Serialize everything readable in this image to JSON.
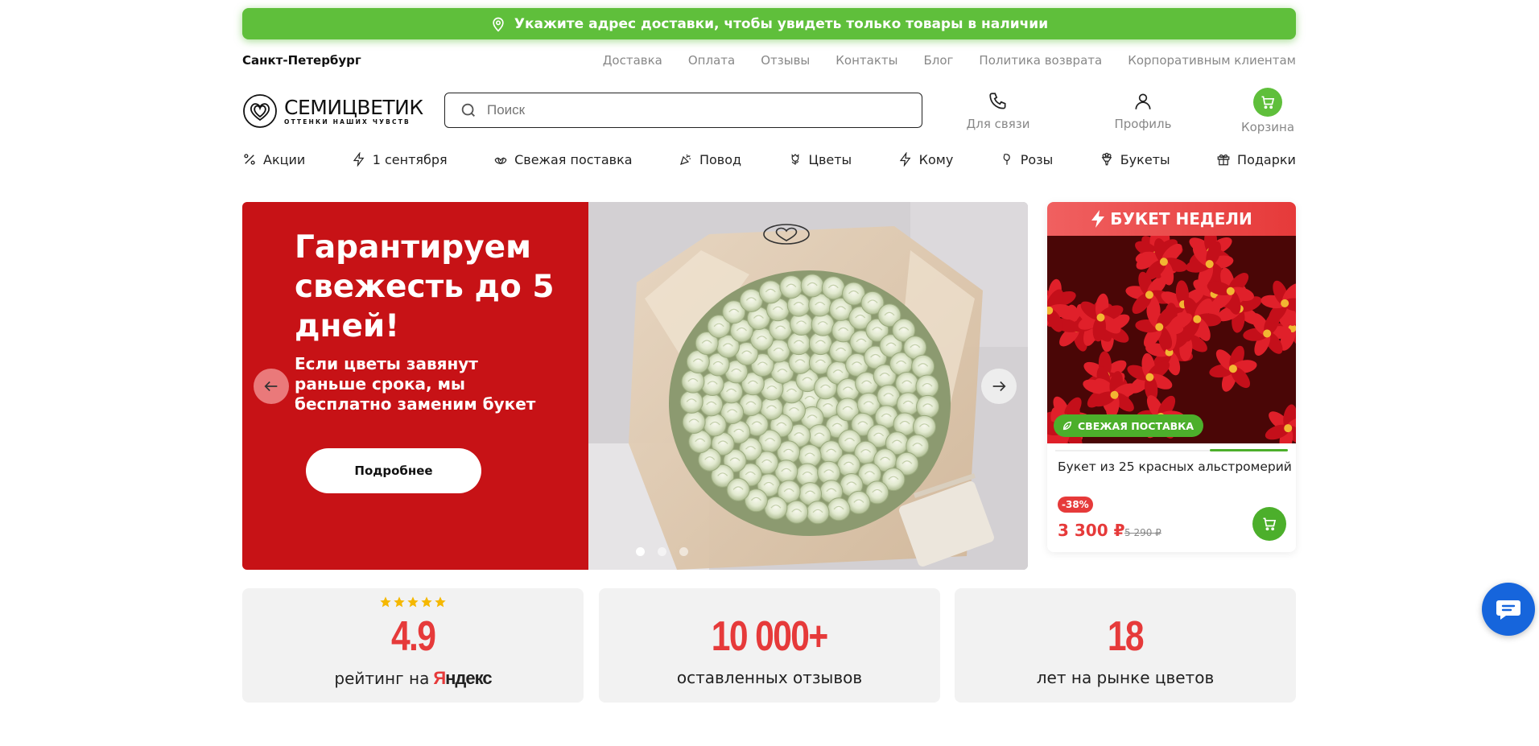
{
  "delivery_banner": {
    "text": "Укажите адрес доставки, чтобы увидеть только товары в наличии"
  },
  "topbar": {
    "city": "Санкт-Петербург",
    "links": [
      "Доставка",
      "Оплата",
      "Отзывы",
      "Контакты",
      "Блог",
      "Политика возврата",
      "Корпоративным клиентам"
    ]
  },
  "header": {
    "logo_name": "СЕМИЦВЕТИК",
    "logo_tagline": "ОТТЕНКИ НАШИХ ЧУВСТВ",
    "search_placeholder": "Поиск",
    "actions": [
      {
        "label": "Для связи",
        "icon": "phone-icon"
      },
      {
        "label": "Профиль",
        "icon": "user-icon"
      },
      {
        "label": "Корзина",
        "icon": "cart-icon"
      }
    ]
  },
  "categories": [
    {
      "label": "Акции",
      "icon": "percent-icon"
    },
    {
      "label": "1 сентября",
      "icon": "lightning-icon"
    },
    {
      "label": "Свежая поставка",
      "icon": "lotus-icon"
    },
    {
      "label": "Повод",
      "icon": "party-popper-icon"
    },
    {
      "label": "Цветы",
      "icon": "tulip-icon"
    },
    {
      "label": "Кому",
      "icon": "lightning-icon"
    },
    {
      "label": "Розы",
      "icon": "rose-icon"
    },
    {
      "label": "Букеты",
      "icon": "bouquet-icon"
    },
    {
      "label": "Подарки",
      "icon": "gift-icon"
    }
  ],
  "hero": {
    "title": "Гарантируем свежесть до 5 дней!",
    "subtitle": "Если цветы завянут раньше срока, мы бесплатно заменим букет",
    "button": "Подробнее",
    "slides_total": 3,
    "active_slide": 1
  },
  "bouquet_of_week": {
    "header": "БУКЕТ НЕДЕЛИ",
    "badge": "СВЕЖАЯ ПОСТАВКА",
    "name": "Букет из 25 красных альстромерий",
    "discount": "-38%",
    "price": "3 300 ₽",
    "old_price": "5 290 ₽"
  },
  "stats": [
    {
      "value": "4.9",
      "label": "рейтинг на",
      "brand": "Яндекс",
      "stars": 5
    },
    {
      "value": "10 000+",
      "label": "оставленных отзывов"
    },
    {
      "value": "18",
      "label": "лет на рынке цветов"
    }
  ],
  "colors": {
    "brand_green": "#5fbf3b",
    "hero_red": "#c71216",
    "accent_red": "#e63a3a",
    "chat_blue": "#1665dc"
  }
}
